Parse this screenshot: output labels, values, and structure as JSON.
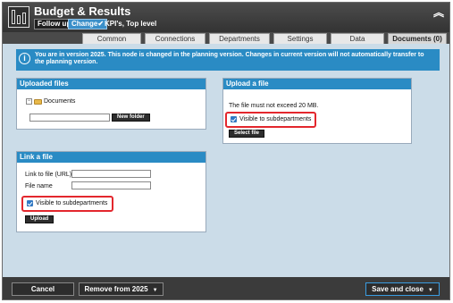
{
  "header": {
    "title": "Budget & Results",
    "follow_up": "Follow up",
    "change": "Change",
    "level": "KPI's, Top level",
    "collapse_icon": "double-chevron-up-icon"
  },
  "tabs": [
    "Common",
    "Connections",
    "Departments",
    "Settings",
    "Data",
    "Documents (0)"
  ],
  "active_tab": "Documents (0)",
  "info": {
    "text": "You are in version 2025. This node is changed in the planning version. Changes in current version will not automatically transfer to the planning version."
  },
  "uploaded": {
    "heading": "Uploaded files",
    "folder": "Documents",
    "new_folder": "New folder",
    "new_folder_value": ""
  },
  "upload": {
    "heading": "Upload a file",
    "note": "The file must not exceed 20 MB.",
    "visible": "Visible to subdepartments",
    "select": "Select file"
  },
  "link": {
    "heading": "Link a file",
    "url_label": "Link to file (URL)",
    "url_value": "",
    "name_label": "File name",
    "name_value": "",
    "visible": "Visible to subdepartments",
    "upload": "Upload"
  },
  "footer": {
    "cancel": "Cancel",
    "remove": "Remove from 2025",
    "save": "Save and close"
  },
  "colors": {
    "accent": "#2a8bc4",
    "highlight": "#e3272d",
    "titlebar": "#3b3b3b"
  }
}
